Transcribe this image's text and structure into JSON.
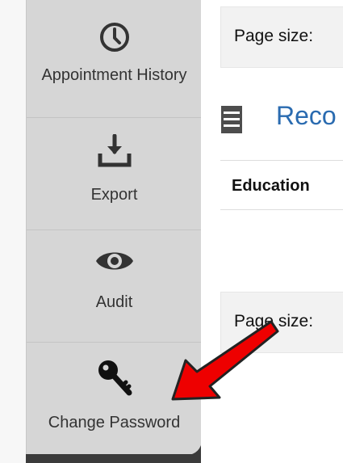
{
  "sidebar": {
    "items": [
      {
        "label": "Appointment History",
        "icon": "clock-icon"
      },
      {
        "label": "Export",
        "icon": "download-icon"
      },
      {
        "label": "Audit",
        "icon": "eye-icon"
      },
      {
        "label": "Change Password",
        "icon": "key-icon"
      }
    ]
  },
  "main": {
    "pager_label": "Page size:",
    "section_title": "Reco",
    "table": {
      "columns": [
        "Education"
      ]
    },
    "bottom_pager_label": "Page size:"
  },
  "colors": {
    "sidebar_bg": "#d6d6d6",
    "heading": "#2a6bb0",
    "annotation_arrow": "#ee0000"
  }
}
